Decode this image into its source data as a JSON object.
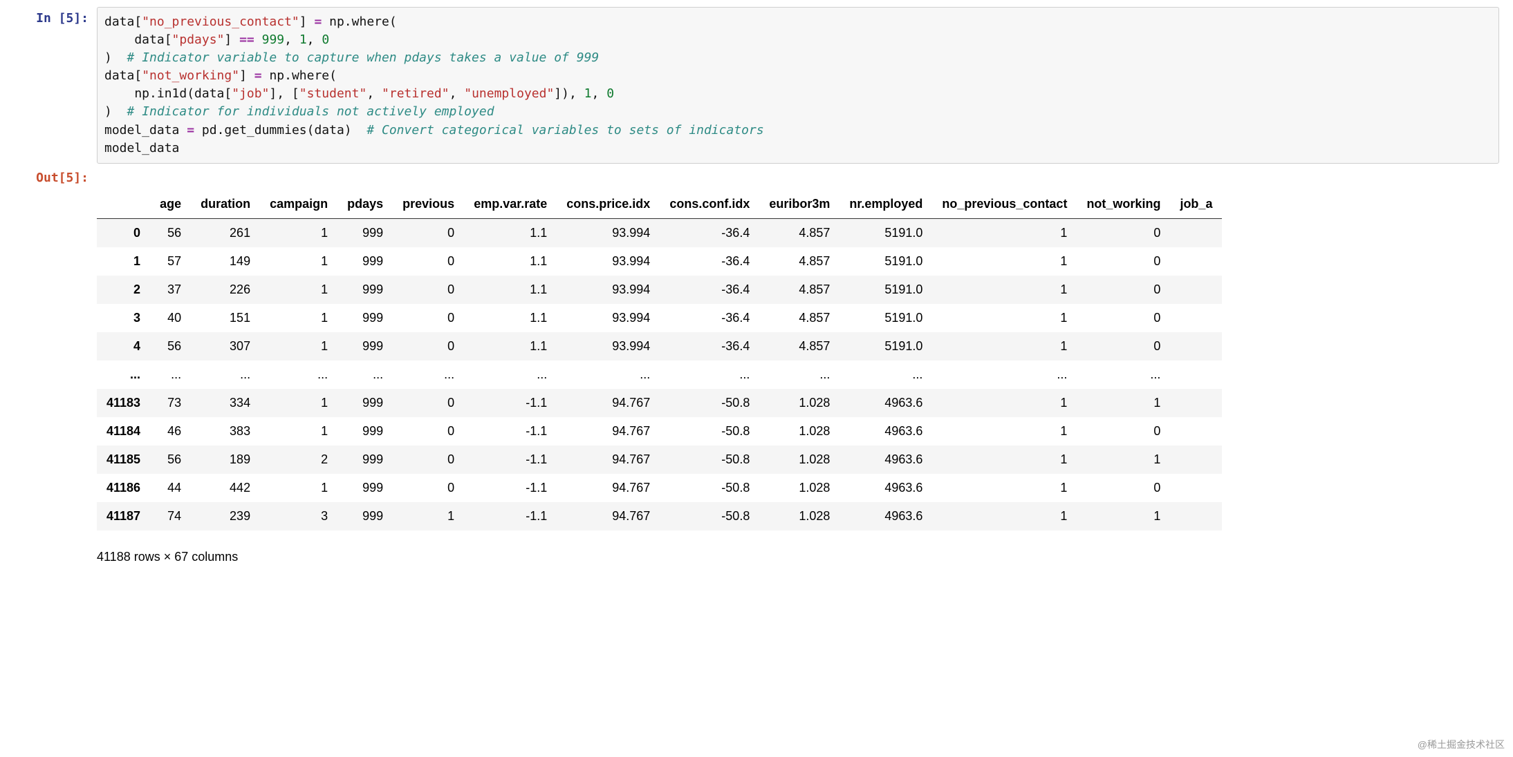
{
  "input_prompt": "In [5]:",
  "output_prompt": "Out[5]:",
  "code": {
    "t1": "data[",
    "s1": "\"no_previous_contact\"",
    "t2": "] ",
    "op_eq": "=",
    "t3": " np.where(",
    "t4": "    data[",
    "s2": "\"pdays\"",
    "t5": "] ",
    "op_eqeq": "==",
    "t6": " ",
    "n999": "999",
    "t7": ", ",
    "n1": "1",
    "t8": ", ",
    "n0": "0",
    "t9": ")  ",
    "c1": "# Indicator variable to capture when pdays takes a value of 999",
    "t10": "data[",
    "s3": "\"not_working\"",
    "t11": "] ",
    "t12": " np.where(",
    "t13": "    np.in1d(data[",
    "s4": "\"job\"",
    "t14": "], [",
    "s5": "\"student\"",
    "t15": ", ",
    "s6": "\"retired\"",
    "t16": ", ",
    "s7": "\"unemployed\"",
    "t17": "]), ",
    "t18": ")  ",
    "c2": "# Indicator for individuals not actively employed",
    "t19": "model_data ",
    "t20": " pd.get_dummies(data)  ",
    "c3": "# Convert categorical variables to sets of indicators",
    "t21": "model_data"
  },
  "table": {
    "columns": [
      "age",
      "duration",
      "campaign",
      "pdays",
      "previous",
      "emp.var.rate",
      "cons.price.idx",
      "cons.conf.idx",
      "euribor3m",
      "nr.employed",
      "no_previous_contact",
      "not_working",
      "job_a"
    ],
    "rows": [
      {
        "idx": "0",
        "v": [
          "56",
          "261",
          "1",
          "999",
          "0",
          "1.1",
          "93.994",
          "-36.4",
          "4.857",
          "5191.0",
          "1",
          "0",
          ""
        ]
      },
      {
        "idx": "1",
        "v": [
          "57",
          "149",
          "1",
          "999",
          "0",
          "1.1",
          "93.994",
          "-36.4",
          "4.857",
          "5191.0",
          "1",
          "0",
          ""
        ]
      },
      {
        "idx": "2",
        "v": [
          "37",
          "226",
          "1",
          "999",
          "0",
          "1.1",
          "93.994",
          "-36.4",
          "4.857",
          "5191.0",
          "1",
          "0",
          ""
        ]
      },
      {
        "idx": "3",
        "v": [
          "40",
          "151",
          "1",
          "999",
          "0",
          "1.1",
          "93.994",
          "-36.4",
          "4.857",
          "5191.0",
          "1",
          "0",
          ""
        ]
      },
      {
        "idx": "4",
        "v": [
          "56",
          "307",
          "1",
          "999",
          "0",
          "1.1",
          "93.994",
          "-36.4",
          "4.857",
          "5191.0",
          "1",
          "0",
          ""
        ]
      },
      {
        "idx": "...",
        "v": [
          "...",
          "...",
          "...",
          "...",
          "...",
          "...",
          "...",
          "...",
          "...",
          "...",
          "...",
          "...",
          ""
        ]
      },
      {
        "idx": "41183",
        "v": [
          "73",
          "334",
          "1",
          "999",
          "0",
          "-1.1",
          "94.767",
          "-50.8",
          "1.028",
          "4963.6",
          "1",
          "1",
          ""
        ]
      },
      {
        "idx": "41184",
        "v": [
          "46",
          "383",
          "1",
          "999",
          "0",
          "-1.1",
          "94.767",
          "-50.8",
          "1.028",
          "4963.6",
          "1",
          "0",
          ""
        ]
      },
      {
        "idx": "41185",
        "v": [
          "56",
          "189",
          "2",
          "999",
          "0",
          "-1.1",
          "94.767",
          "-50.8",
          "1.028",
          "4963.6",
          "1",
          "1",
          ""
        ]
      },
      {
        "idx": "41186",
        "v": [
          "44",
          "442",
          "1",
          "999",
          "0",
          "-1.1",
          "94.767",
          "-50.8",
          "1.028",
          "4963.6",
          "1",
          "0",
          ""
        ]
      },
      {
        "idx": "41187",
        "v": [
          "74",
          "239",
          "3",
          "999",
          "1",
          "-1.1",
          "94.767",
          "-50.8",
          "1.028",
          "4963.6",
          "1",
          "1",
          ""
        ]
      }
    ]
  },
  "summary": "41188 rows × 67 columns",
  "watermark": "@稀土掘金技术社区"
}
